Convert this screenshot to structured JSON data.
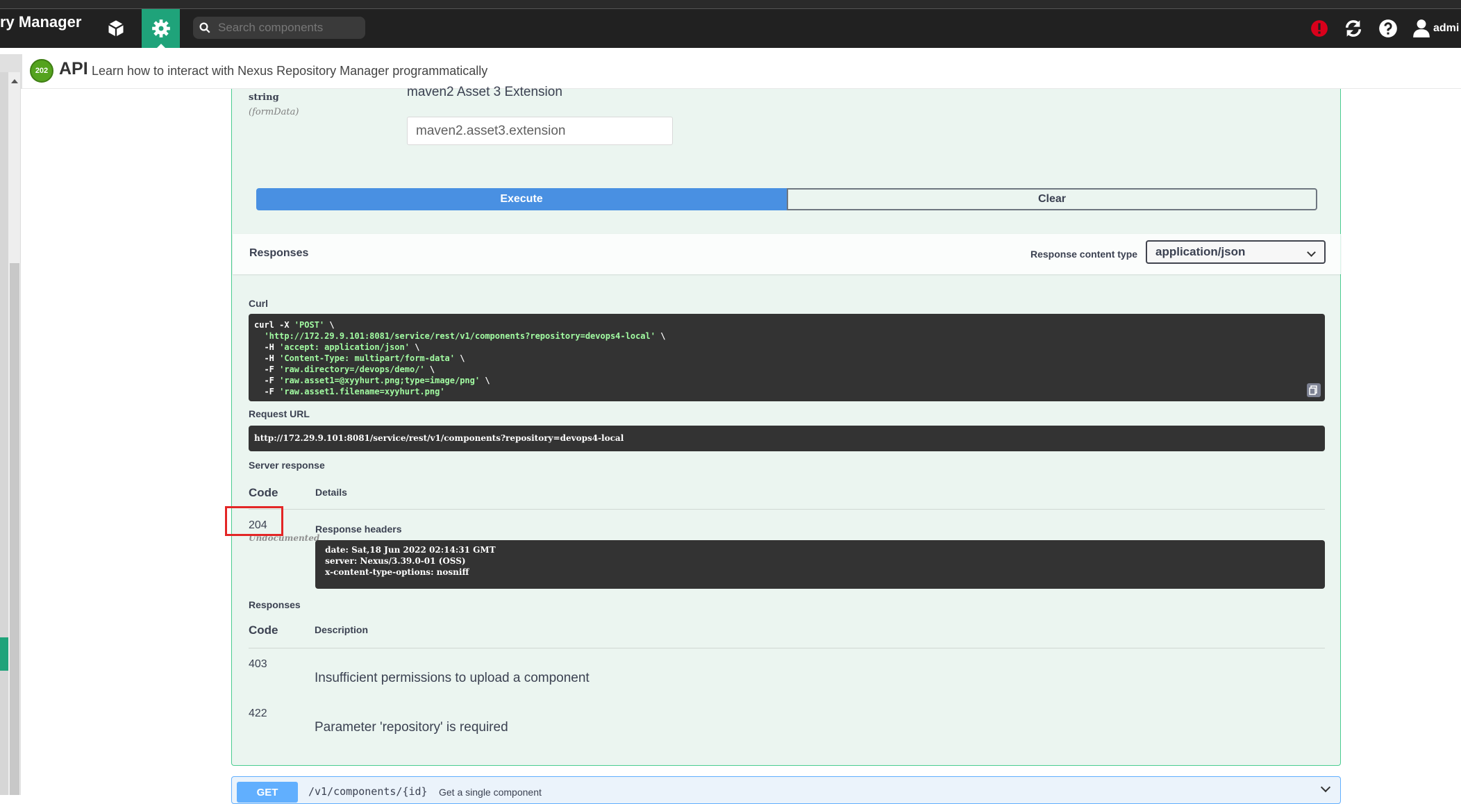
{
  "header": {
    "app_title": "ry Manager",
    "search_placeholder": "Search components",
    "user_name": "admi",
    "accent_color": "#1fa37a"
  },
  "subheader": {
    "badge": "202",
    "title": "API",
    "description": "Learn how to interact with Nexus Repository Manager programmatically"
  },
  "param": {
    "type": "string",
    "in": "(formData)",
    "description": "maven2 Asset 3 Extension",
    "placeholder": "maven2.asset3.extension"
  },
  "buttons": {
    "execute": "Execute",
    "clear": "Clear"
  },
  "responses_header": {
    "title": "Responses",
    "content_type_label": "Response content type",
    "content_type_value": "application/json"
  },
  "curl": {
    "label": "Curl",
    "lines": [
      {
        "prefix": "curl -X ",
        "str": "'POST'",
        "suffix": " \\"
      },
      {
        "prefix": "  ",
        "str": "'http://172.29.9.101:8081/service/rest/v1/components?repository=devops4-local'",
        "suffix": " \\"
      },
      {
        "prefix": "  -H ",
        "str": "'accept: application/json'",
        "suffix": " \\"
      },
      {
        "prefix": "  -H ",
        "str": "'Content-Type: multipart/form-data'",
        "suffix": " \\"
      },
      {
        "prefix": "  -F ",
        "str": "'raw.directory=/devops/demo/'",
        "suffix": " \\"
      },
      {
        "prefix": "  -F ",
        "str": "'raw.asset1=@xyyhurt.png;type=image/png'",
        "suffix": " \\"
      },
      {
        "prefix": "  -F ",
        "str": "'raw.asset1.filename=xyyhurt.png'",
        "suffix": ""
      }
    ]
  },
  "request_url": {
    "label": "Request URL",
    "value": "http://172.29.9.101:8081/service/rest/v1/components?repository=devops4-local"
  },
  "server_response": {
    "label": "Server response",
    "code_header": "Code",
    "details_header": "Details",
    "code": "204",
    "undocumented": "Undocumented",
    "headers_label": "Response headers",
    "headers_text": " date: Sat,18 Jun 2022 02:14:31 GMT \n server: Nexus/3.39.0-01 (OSS) \n x-content-type-options: nosniff "
  },
  "responses": {
    "label": "Responses",
    "code_header": "Code",
    "description_header": "Description",
    "rows": [
      {
        "code": "403",
        "description": "Insufficient permissions to upload a component"
      },
      {
        "code": "422",
        "description": "Parameter 'repository' is required"
      }
    ]
  },
  "next_operation": {
    "method": "GET",
    "path": "/v1/components/{id}",
    "summary": "Get a single component"
  }
}
